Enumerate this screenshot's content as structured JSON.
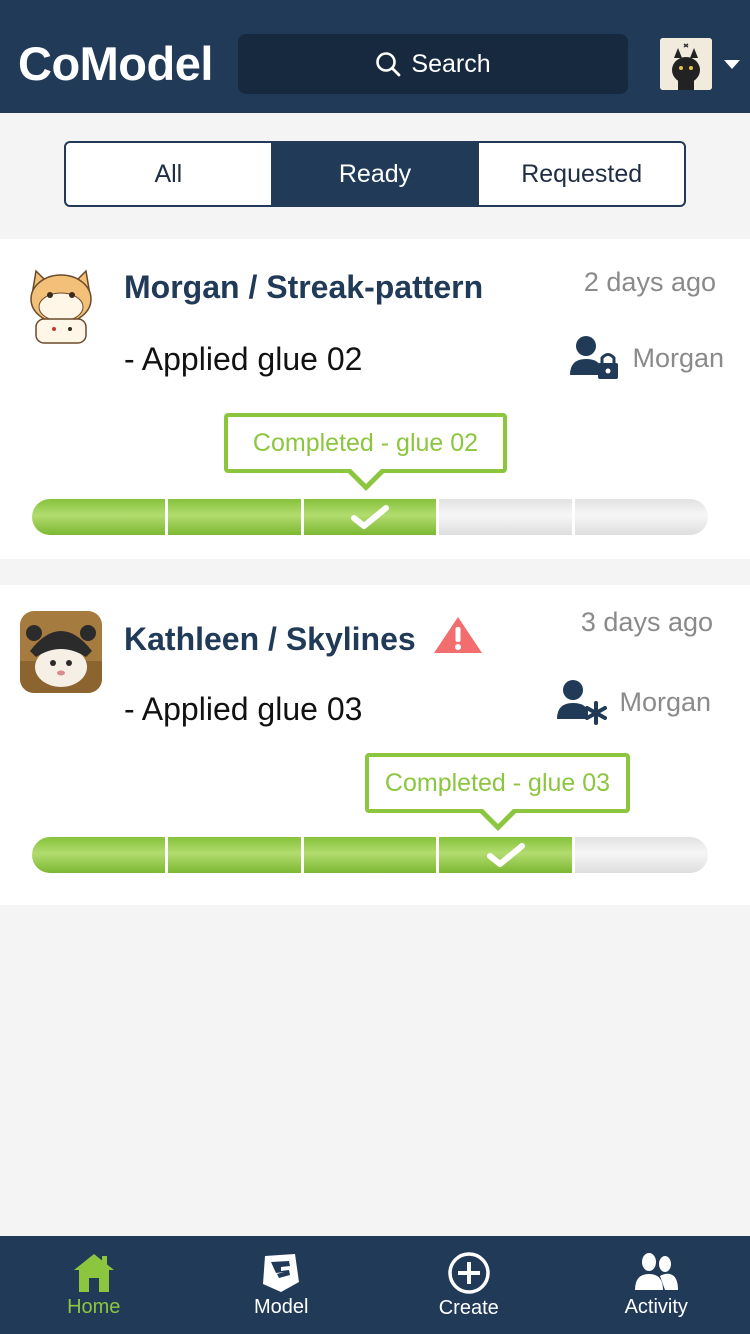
{
  "app": {
    "title": "CoModel"
  },
  "search": {
    "label": "Search"
  },
  "filters": [
    {
      "label": "All",
      "active": false
    },
    {
      "label": "Ready",
      "active": true
    },
    {
      "label": "Requested",
      "active": false
    }
  ],
  "cards": [
    {
      "title": "Morgan / Streak-pattern",
      "time": "2 days ago",
      "step": "- Applied glue 02",
      "owner": "Morgan",
      "owner_icon": "user-lock-icon",
      "tooltip": "Completed - glue 02",
      "progress": {
        "completed": 3,
        "total": 5
      },
      "warning": false
    },
    {
      "title": "Kathleen / Skylines",
      "time": "3 days ago",
      "step": "- Applied glue 03",
      "owner": "Morgan",
      "owner_icon": "user-asterisk-icon",
      "tooltip": "Completed - glue 03",
      "progress": {
        "completed": 4,
        "total": 5
      },
      "warning": true
    }
  ],
  "nav": [
    {
      "label": "Home",
      "icon": "home-icon",
      "active": true
    },
    {
      "label": "Model",
      "icon": "model-icon",
      "active": false
    },
    {
      "label": "Create",
      "icon": "plus-circle-icon",
      "active": false
    },
    {
      "label": "Activity",
      "icon": "users-icon",
      "active": false
    }
  ],
  "colors": {
    "primary": "#213a58",
    "accent": "#8cc63f",
    "warning": "#f26d6d",
    "muted": "#8a8a8a"
  }
}
